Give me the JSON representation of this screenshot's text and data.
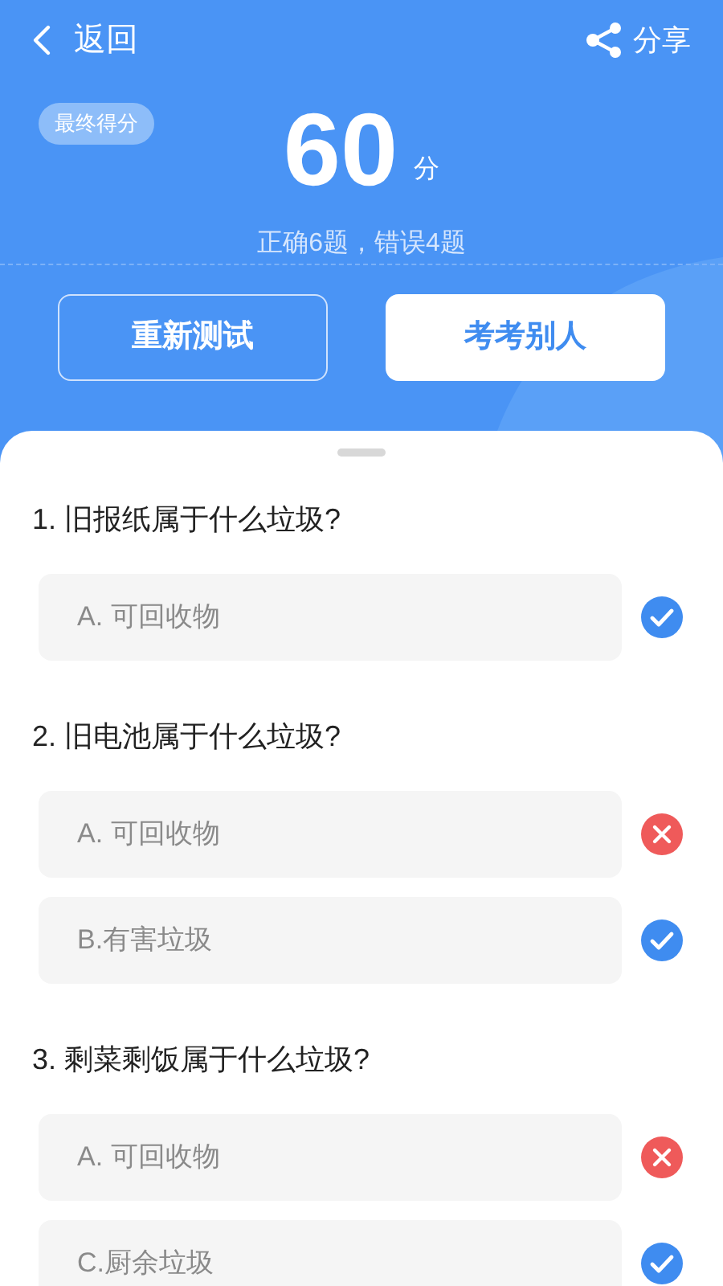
{
  "nav": {
    "back": "返回",
    "share": "分享"
  },
  "score": {
    "badge": "最终得分",
    "value": "60",
    "unit": "分",
    "summary": "正确6题，错误4题"
  },
  "actions": [
    {
      "label": "重新测试",
      "kind": "outline"
    },
    {
      "label": "考考别人",
      "kind": "solid"
    }
  ],
  "questions": [
    {
      "title": "1. 旧报纸属于什么垃圾?",
      "options": [
        {
          "label": "A. 可回收物",
          "kind": "correct"
        }
      ]
    },
    {
      "title": "2. 旧电池属于什么垃圾?",
      "options": [
        {
          "label": "A. 可回收物",
          "kind": "wrong"
        },
        {
          "label": "B.有害垃圾",
          "kind": "correct"
        }
      ]
    },
    {
      "title": "3. 剩菜剩饭属于什么垃圾?",
      "options": [
        {
          "label": "A. 可回收物",
          "kind": "wrong"
        },
        {
          "label": "C.厨余垃圾",
          "kind": "correct"
        }
      ]
    }
  ]
}
